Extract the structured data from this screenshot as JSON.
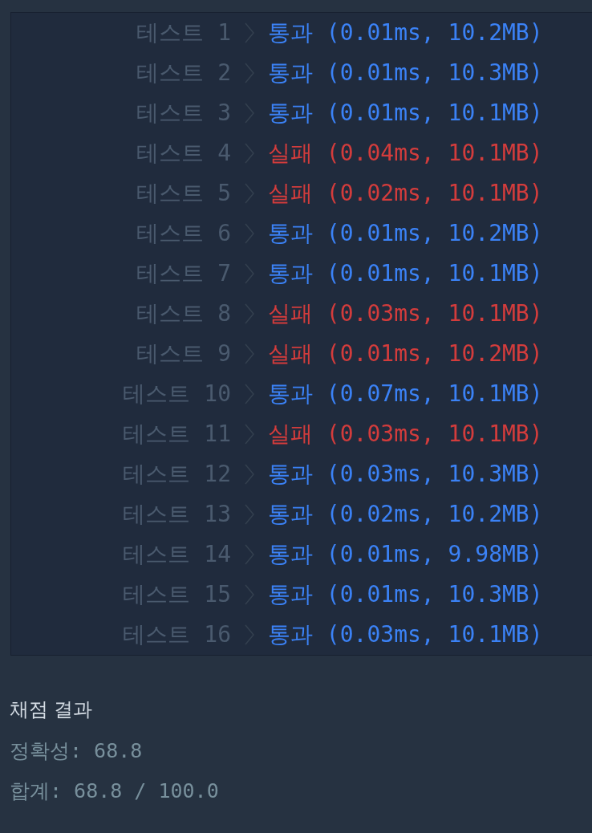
{
  "tests": [
    {
      "label": "테스트 1",
      "result": "통과 (0.01ms, 10.2MB)",
      "passed": true
    },
    {
      "label": "테스트 2",
      "result": "통과 (0.01ms, 10.3MB)",
      "passed": true
    },
    {
      "label": "테스트 3",
      "result": "통과 (0.01ms, 10.1MB)",
      "passed": true
    },
    {
      "label": "테스트 4",
      "result": "실패 (0.04ms, 10.1MB)",
      "passed": false
    },
    {
      "label": "테스트 5",
      "result": "실패 (0.02ms, 10.1MB)",
      "passed": false
    },
    {
      "label": "테스트 6",
      "result": "통과 (0.01ms, 10.2MB)",
      "passed": true
    },
    {
      "label": "테스트 7",
      "result": "통과 (0.01ms, 10.1MB)",
      "passed": true
    },
    {
      "label": "테스트 8",
      "result": "실패 (0.03ms, 10.1MB)",
      "passed": false
    },
    {
      "label": "테스트 9",
      "result": "실패 (0.01ms, 10.2MB)",
      "passed": false
    },
    {
      "label": "테스트 10",
      "result": "통과 (0.07ms, 10.1MB)",
      "passed": true
    },
    {
      "label": "테스트 11",
      "result": "실패 (0.03ms, 10.1MB)",
      "passed": false
    },
    {
      "label": "테스트 12",
      "result": "통과 (0.03ms, 10.3MB)",
      "passed": true
    },
    {
      "label": "테스트 13",
      "result": "통과 (0.02ms, 10.2MB)",
      "passed": true
    },
    {
      "label": "테스트 14",
      "result": "통과 (0.01ms, 9.98MB)",
      "passed": true
    },
    {
      "label": "테스트 15",
      "result": "통과 (0.01ms, 10.3MB)",
      "passed": true
    },
    {
      "label": "테스트 16",
      "result": "통과 (0.03ms, 10.1MB)",
      "passed": true
    }
  ],
  "summary": {
    "title": "채점 결과",
    "lines": [
      "정확성: 68.8",
      "합계: 68.8 / 100.0"
    ]
  }
}
